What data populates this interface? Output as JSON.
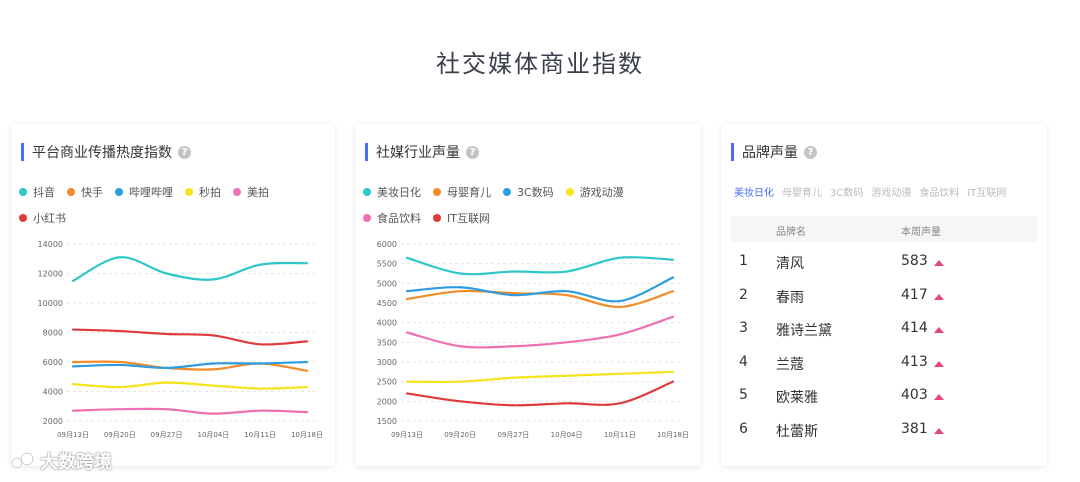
{
  "page": {
    "title": "社交媒体商业指数"
  },
  "watermark": {
    "text": "大数跨境"
  },
  "card1": {
    "title": "平台商业传播热度指数"
  },
  "card2": {
    "title": "社媒行业声量"
  },
  "card3": {
    "title": "品牌声量",
    "tabs": [
      "美妆日化",
      "母婴育儿",
      "3C数码",
      "游戏动漫",
      "食品饮料",
      "IT互联网"
    ],
    "table_headers": {
      "name": "品牌名",
      "volume": "本周声量"
    },
    "rows": [
      {
        "rank": "1",
        "name": "清风",
        "volume": "583"
      },
      {
        "rank": "2",
        "name": "春雨",
        "volume": "417"
      },
      {
        "rank": "3",
        "name": "雅诗兰黛",
        "volume": "414"
      },
      {
        "rank": "4",
        "name": "兰蔻",
        "volume": "413"
      },
      {
        "rank": "5",
        "name": "欧莱雅",
        "volume": "403"
      },
      {
        "rank": "6",
        "name": "杜蕾斯",
        "volume": "381"
      }
    ],
    "trend_icon": "triangle-up-icon",
    "trend_color": "#e8457a"
  },
  "chart_data": [
    {
      "type": "line",
      "title": "平台商业传播热度指数",
      "x": [
        "09月13日",
        "09月20日",
        "09月27日",
        "10月04日",
        "10月11日",
        "10月18日"
      ],
      "ylim": [
        2000,
        14000
      ],
      "yticks": [
        2000,
        4000,
        6000,
        8000,
        10000,
        12000,
        14000
      ],
      "grid": true,
      "legend": "top",
      "series": [
        {
          "name": "抖音",
          "color": "#2ec7c9",
          "values": [
            11500,
            13100,
            12000,
            11600,
            12600,
            12700
          ]
        },
        {
          "name": "快手",
          "color": "#f28c28",
          "values": [
            6000,
            6000,
            5600,
            5500,
            5900,
            5400
          ]
        },
        {
          "name": "哔哩哔哩",
          "color": "#2f9be0",
          "values": [
            5700,
            5800,
            5600,
            5900,
            5900,
            6000
          ]
        },
        {
          "name": "秒拍",
          "color": "#f5e31b",
          "values": [
            4500,
            4300,
            4600,
            4400,
            4200,
            4300
          ]
        },
        {
          "name": "美拍",
          "color": "#ef6fb3",
          "values": [
            2700,
            2800,
            2800,
            2500,
            2700,
            2600
          ]
        },
        {
          "name": "小红书",
          "color": "#e03a3a",
          "values": [
            8200,
            8100,
            7900,
            7800,
            7200,
            7400
          ]
        }
      ]
    },
    {
      "type": "line",
      "title": "社媒行业声量",
      "x": [
        "09月13日",
        "09月20日",
        "09月27日",
        "10月04日",
        "10月11日",
        "10月18日"
      ],
      "ylim": [
        1500,
        6000
      ],
      "yticks": [
        1500,
        2000,
        2500,
        3000,
        3500,
        4000,
        4500,
        5000,
        5500,
        6000
      ],
      "grid": true,
      "legend": "top",
      "series": [
        {
          "name": "美妆日化",
          "color": "#2ec7c9",
          "values": [
            5650,
            5250,
            5300,
            5300,
            5650,
            5600
          ]
        },
        {
          "name": "母婴育儿",
          "color": "#f28c28",
          "values": [
            4600,
            4800,
            4750,
            4700,
            4400,
            4800
          ]
        },
        {
          "name": "3C数码",
          "color": "#2f9be0",
          "values": [
            4800,
            4900,
            4700,
            4800,
            4550,
            5150
          ]
        },
        {
          "name": "游戏动漫",
          "color": "#f5e31b",
          "values": [
            2500,
            2500,
            2600,
            2650,
            2700,
            2750
          ]
        },
        {
          "name": "食品饮料",
          "color": "#ef6fb3",
          "values": [
            3750,
            3400,
            3400,
            3500,
            3700,
            4150
          ]
        },
        {
          "name": "IT互联网",
          "color": "#e03a3a",
          "values": [
            2200,
            2000,
            1900,
            1950,
            1950,
            2500
          ]
        }
      ]
    }
  ]
}
